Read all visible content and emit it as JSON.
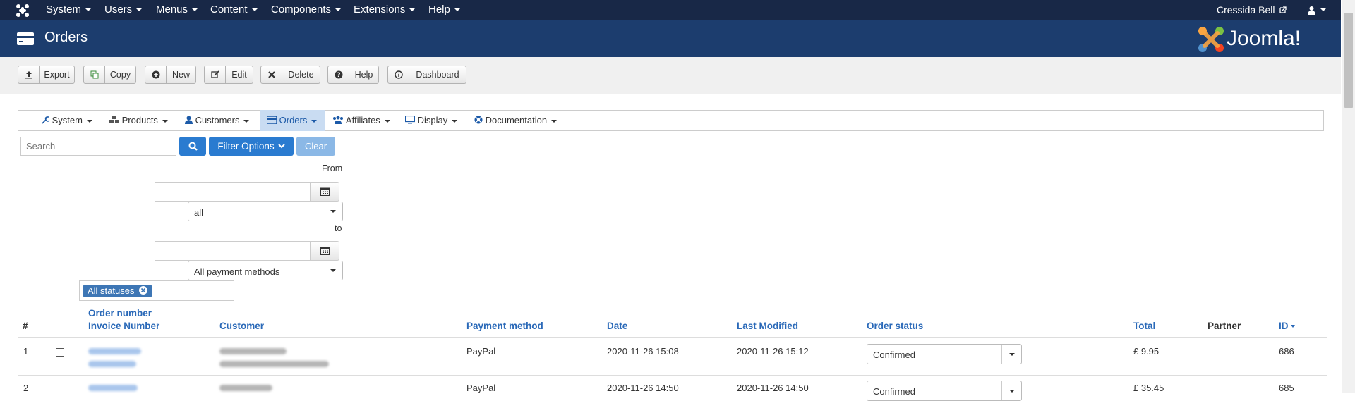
{
  "topbar": {
    "menus": [
      "System",
      "Users",
      "Menus",
      "Content",
      "Components",
      "Extensions",
      "Help"
    ],
    "user_name": "Cressida Bell"
  },
  "header": {
    "title": "Orders",
    "brand": "Joomla!"
  },
  "toolbar": {
    "export": "Export",
    "copy": "Copy",
    "new": "New",
    "edit": "Edit",
    "delete": "Delete",
    "help": "Help",
    "dashboard": "Dashboard"
  },
  "submenu": {
    "system": "System",
    "products": "Products",
    "customers": "Customers",
    "orders": "Orders",
    "affiliates": "Affiliates",
    "display": "Display",
    "documentation": "Documentation"
  },
  "filters": {
    "search_placeholder": "Search",
    "filter_options": "Filter Options",
    "clear": "Clear",
    "from_label": "From",
    "to_label": "to",
    "date_type_value": "all",
    "payment_methods_value": "All payment methods",
    "status_chip": "All statuses"
  },
  "table": {
    "headers": {
      "num": "#",
      "order_number": "Order number",
      "invoice_number": "Invoice Number",
      "customer": "Customer",
      "payment_method": "Payment method",
      "date": "Date",
      "last_modified": "Last Modified",
      "order_status": "Order status",
      "total": "Total",
      "partner": "Partner",
      "id": "ID"
    },
    "rows": [
      {
        "num": "1",
        "payment": "PayPal",
        "date": "2020-11-26 15:08",
        "modified": "2020-11-26 15:12",
        "status": "Confirmed",
        "total": "£ 9.95",
        "id": "686"
      },
      {
        "num": "2",
        "payment": "PayPal",
        "date": "2020-11-26 14:50",
        "modified": "2020-11-26 14:50",
        "status": "Confirmed",
        "total": "£ 35.45",
        "id": "685"
      }
    ]
  },
  "colors": {
    "topbar": "#182847",
    "header": "#1c3d6e",
    "link": "#2a69b8",
    "primary_button": "#2a7bd0"
  }
}
